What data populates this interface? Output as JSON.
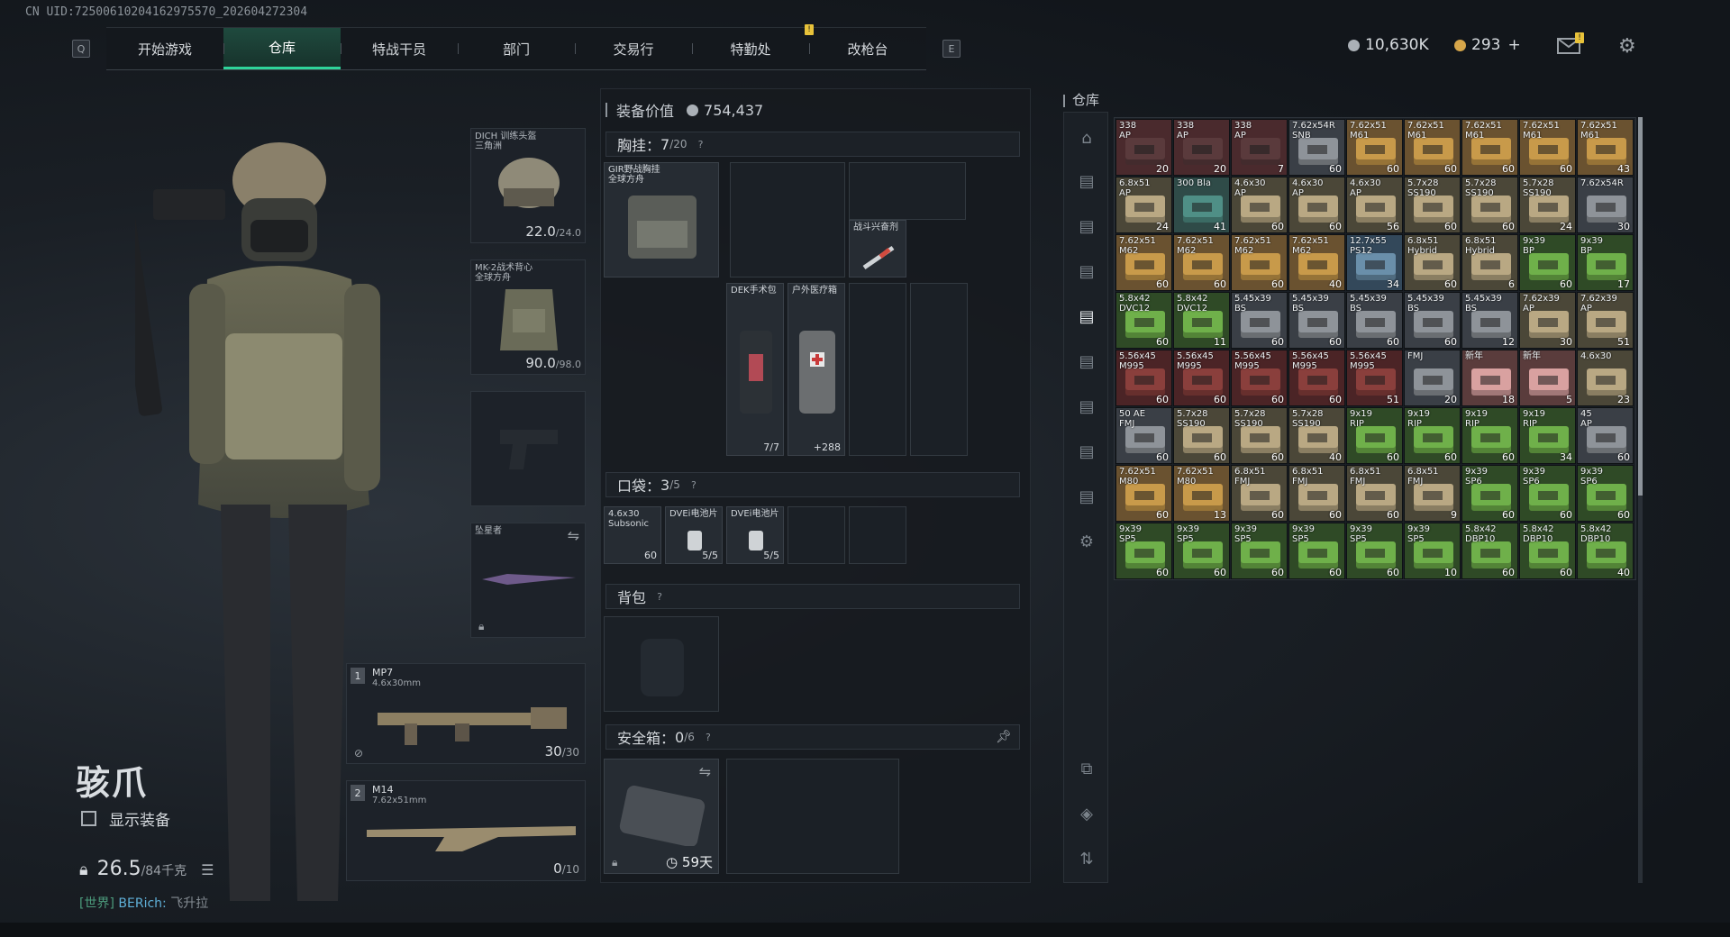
{
  "uid": "CN UID:7250061020416297557​0_202604272304",
  "nav": {
    "left_key": "Q",
    "right_key": "E",
    "tabs": [
      "开始游戏",
      "仓库",
      "特战干员",
      "部门",
      "交易行",
      "特勤处",
      "改枪台"
    ],
    "active_index": 1
  },
  "currency": {
    "silver": "10,630K",
    "gold": "293",
    "plus": "+"
  },
  "character": {
    "name": "骇爪",
    "show_equip": "显示装备",
    "weight": "26.5",
    "weight_max": "/84千克"
  },
  "chat": {
    "channel": "[世界]",
    "sender": "BERich:",
    "message": "飞升拉"
  },
  "equip": {
    "helmet": {
      "label": "DICH 训练头盔",
      "label2": "三角洲",
      "dur": "22.0",
      "max": "/24.0"
    },
    "armor": {
      "label": "MK-2战术背心",
      "label2": "全球方舟",
      "dur": "90.0",
      "max": "/98.0"
    },
    "melee": {
      "label": "坠星者"
    },
    "weapon1": {
      "num": "1",
      "name": "MP7",
      "cal": "4.6x30mm",
      "ammo": "30",
      "max": "/30"
    },
    "weapon2": {
      "num": "2",
      "name": "M14",
      "cal": "7.62x51mm",
      "ammo": "0",
      "max": "/10"
    }
  },
  "loadout": {
    "value_label": "装备价值",
    "value": "754,437",
    "chest": {
      "label": "胸挂：",
      "count": "7",
      "cap": "/20"
    },
    "pocket": {
      "label": "口袋：",
      "count": "3",
      "cap": "/5"
    },
    "backpack": {
      "label": "背包"
    },
    "safe": {
      "label": "安全箱：",
      "count": "0",
      "cap": "/6",
      "timer": "59天"
    },
    "chest_items": [
      {
        "name": "GIR野战胸挂",
        "name2": "全球方舟"
      },
      {
        "name": "战斗兴奋剂"
      },
      {
        "name": "DEK手术包",
        "count": "7/7"
      },
      {
        "name": "户外医疗箱",
        "count": "+288"
      }
    ],
    "pocket_items": [
      {
        "name": "4.6x30",
        "name2": "Subsonic",
        "count": "60"
      },
      {
        "name": "DVEi电池片",
        "count": "5/5"
      },
      {
        "name": "DVEi电池片",
        "count": "5/5"
      }
    ]
  },
  "warehouse": {
    "title": "仓库",
    "items": [
      {
        "n": "338",
        "n2": "AP",
        "c": "20",
        "t": "dark"
      },
      {
        "n": "338",
        "n2": "AP",
        "c": "20",
        "t": "dark"
      },
      {
        "n": "338",
        "n2": "AP",
        "c": "7",
        "t": "dark"
      },
      {
        "n": "7.62x54R",
        "n2": "SNB",
        "c": "60",
        "t": "grey"
      },
      {
        "n": "7.62x51",
        "n2": "M61",
        "c": "60",
        "t": "gold"
      },
      {
        "n": "7.62x51",
        "n2": "M61",
        "c": "60",
        "t": "gold"
      },
      {
        "n": "7.62x51",
        "n2": "M61",
        "c": "60",
        "t": "gold"
      },
      {
        "n": "7.62x51",
        "n2": "M61",
        "c": "60",
        "t": "gold"
      },
      {
        "n": "7.62x51",
        "n2": "M61",
        "c": "43",
        "t": "gold"
      },
      {
        "n": "6.8x51",
        "n2": "AP",
        "c": "24",
        "t": "tan"
      },
      {
        "n": "300 Bla",
        "n2": "",
        "c": "41",
        "t": "teal"
      },
      {
        "n": "4.6x30",
        "n2": "AP",
        "c": "60",
        "t": "tan"
      },
      {
        "n": "4.6x30",
        "n2": "AP",
        "c": "60",
        "t": "tan"
      },
      {
        "n": "4.6x30",
        "n2": "AP",
        "c": "56",
        "t": "tan"
      },
      {
        "n": "5.7x28",
        "n2": "SS190",
        "c": "60",
        "t": "tan"
      },
      {
        "n": "5.7x28",
        "n2": "SS190",
        "c": "60",
        "t": "tan"
      },
      {
        "n": "5.7x28",
        "n2": "SS190",
        "c": "24",
        "t": "tan"
      },
      {
        "n": "7.62x54R",
        "n2": "",
        "c": "30",
        "t": "grey"
      },
      {
        "n": "7.62x51",
        "n2": "M62",
        "c": "60",
        "t": "gold"
      },
      {
        "n": "7.62x51",
        "n2": "M62",
        "c": "60",
        "t": "gold"
      },
      {
        "n": "7.62x51",
        "n2": "M62",
        "c": "60",
        "t": "gold"
      },
      {
        "n": "7.62x51",
        "n2": "M62",
        "c": "40",
        "t": "gold"
      },
      {
        "n": "12.7x55",
        "n2": "PS12",
        "c": "34",
        "t": "blue"
      },
      {
        "n": "6.8x51",
        "n2": "Hybrid",
        "c": "60",
        "t": "tan"
      },
      {
        "n": "6.8x51",
        "n2": "Hybrid",
        "c": "6",
        "t": "tan"
      },
      {
        "n": "9x39",
        "n2": "BP",
        "c": "60",
        "t": "green"
      },
      {
        "n": "9x39",
        "n2": "BP",
        "c": "17",
        "t": "green"
      },
      {
        "n": "5.8x42",
        "n2": "DVC12",
        "c": "60",
        "t": "green"
      },
      {
        "n": "5.8x42",
        "n2": "DVC12",
        "c": "11",
        "t": "green"
      },
      {
        "n": "5.45x39",
        "n2": "BS",
        "c": "60",
        "t": "grey"
      },
      {
        "n": "5.45x39",
        "n2": "BS",
        "c": "60",
        "t": "grey"
      },
      {
        "n": "5.45x39",
        "n2": "BS",
        "c": "60",
        "t": "grey"
      },
      {
        "n": "5.45x39",
        "n2": "BS",
        "c": "60",
        "t": "grey"
      },
      {
        "n": "5.45x39",
        "n2": "BS",
        "c": "12",
        "t": "grey"
      },
      {
        "n": "7.62x39",
        "n2": "AP",
        "c": "30",
        "t": "tan"
      },
      {
        "n": "7.62x39",
        "n2": "AP",
        "c": "51",
        "t": "tan"
      },
      {
        "n": "5.56x45",
        "n2": "M995",
        "c": "60",
        "t": "red"
      },
      {
        "n": "5.56x45",
        "n2": "M995",
        "c": "60",
        "t": "red"
      },
      {
        "n": "5.56x45",
        "n2": "M995",
        "c": "60",
        "t": "red"
      },
      {
        "n": "5.56x45",
        "n2": "M995",
        "c": "60",
        "t": "red"
      },
      {
        "n": "5.56x45",
        "n2": "M995",
        "c": "51",
        "t": "red"
      },
      {
        "n": "FMJ",
        "n2": "",
        "c": "20",
        "t": "grey"
      },
      {
        "n": "新年",
        "n2": "",
        "c": "18",
        "t": "pink"
      },
      {
        "n": "新年",
        "n2": "",
        "c": "5",
        "t": "pink"
      },
      {
        "n": "4.6x30",
        "n2": "",
        "c": "23",
        "t": "tan"
      },
      {
        "n": "50 AE",
        "n2": "FMJ",
        "c": "60",
        "t": "grey"
      },
      {
        "n": "5.7x28",
        "n2": "SS190",
        "c": "60",
        "t": "tan"
      },
      {
        "n": "5.7x28",
        "n2": "SS190",
        "c": "60",
        "t": "tan"
      },
      {
        "n": "5.7x28",
        "n2": "SS190",
        "c": "40",
        "t": "tan"
      },
      {
        "n": "9x19",
        "n2": "RIP",
        "c": "60",
        "t": "green"
      },
      {
        "n": "9x19",
        "n2": "RIP",
        "c": "60",
        "t": "green"
      },
      {
        "n": "9x19",
        "n2": "RIP",
        "c": "60",
        "t": "green"
      },
      {
        "n": "9x19",
        "n2": "RIP",
        "c": "34",
        "t": "green"
      },
      {
        "n": "45",
        "n2": "AP",
        "c": "60",
        "t": "grey"
      },
      {
        "n": "7.62x51",
        "n2": "M80",
        "c": "60",
        "t": "gold"
      },
      {
        "n": "7.62x51",
        "n2": "M80",
        "c": "13",
        "t": "gold"
      },
      {
        "n": "6.8x51",
        "n2": "FMJ",
        "c": "60",
        "t": "tan"
      },
      {
        "n": "6.8x51",
        "n2": "FMJ",
        "c": "60",
        "t": "tan"
      },
      {
        "n": "6.8x51",
        "n2": "FMJ",
        "c": "60",
        "t": "tan"
      },
      {
        "n": "6.8x51",
        "n2": "FMJ",
        "c": "9",
        "t": "tan"
      },
      {
        "n": "9x39",
        "n2": "SP6",
        "c": "60",
        "t": "green"
      },
      {
        "n": "9x39",
        "n2": "SP6",
        "c": "60",
        "t": "green"
      },
      {
        "n": "9x39",
        "n2": "SP6",
        "c": "60",
        "t": "green"
      },
      {
        "n": "9x39",
        "n2": "SP5",
        "c": "60",
        "t": "green"
      },
      {
        "n": "9x39",
        "n2": "SP5",
        "c": "60",
        "t": "green"
      },
      {
        "n": "9x39",
        "n2": "SP5",
        "c": "60",
        "t": "green"
      },
      {
        "n": "9x39",
        "n2": "SP5",
        "c": "60",
        "t": "green"
      },
      {
        "n": "9x39",
        "n2": "SP5",
        "c": "60",
        "t": "green"
      },
      {
        "n": "9x39",
        "n2": "SP5",
        "c": "10",
        "t": "green"
      },
      {
        "n": "5.8x42",
        "n2": "DBP10",
        "c": "60",
        "t": "green"
      },
      {
        "n": "5.8x42",
        "n2": "DBP10",
        "c": "60",
        "t": "green"
      },
      {
        "n": "5.8x42",
        "n2": "DBP10",
        "c": "40",
        "t": "green"
      }
    ],
    "type_colors": {
      "dark": "#5a3a3c",
      "grey": "#8e9399",
      "gold": "#c89a4a",
      "tan": "#b9a883",
      "teal": "#4f8f86",
      "blue": "#6a8faa",
      "green": "#6fb04a",
      "red": "#8a3f3c",
      "pink": "#d9a1a0"
    },
    "cell_bg": {
      "dark": "#4a2a2d",
      "grey": "#3a3f46",
      "gold": "#6a5230",
      "tan": "#4b4738",
      "teal": "#2f4b48",
      "blue": "#33485a",
      "green": "#2f4a26",
      "red": "#4b2426",
      "pink": "#5a3c3c"
    }
  },
  "colors": {
    "accent": "#2fd39a",
    "silver": "#aab0b6",
    "gold": "#d6a64a"
  }
}
